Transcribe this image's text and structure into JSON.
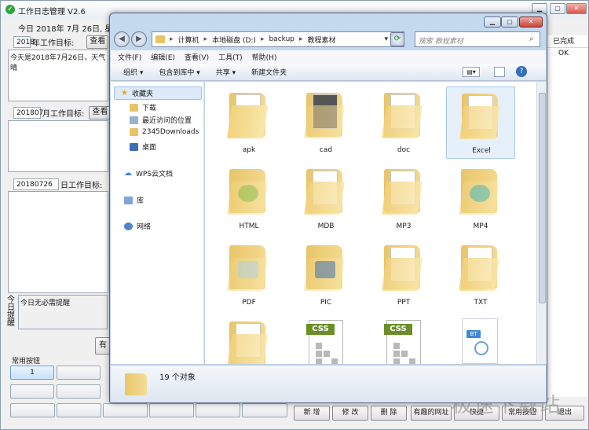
{
  "app": {
    "title": "工作日志管理 V2.6",
    "date_text": "今日 2018年 7月 26日, 星期",
    "year_input": "2018",
    "year_goal_label": "年工作目标:",
    "view_button": "查看",
    "today_text": "今天是2018年7月26日，天气晴",
    "month_input": "201807",
    "month_goal_label": "月工作目标:",
    "day_input": "20180726",
    "day_goal_label": "日工作目标:",
    "reminder_side_label": "今日提醒",
    "reminder_text": "今日无必需提醒",
    "partial_button": "有",
    "common_buttons_label": "常用按钮",
    "quick_first_label": "1",
    "bottom_buttons": [
      "新 增",
      "修 改",
      "删 除",
      "有趣的网址",
      "快捷",
      "常用按钮",
      "退出"
    ],
    "right_header": "已完成",
    "right_value": "OK",
    "watermark": "极速下载站"
  },
  "explorer": {
    "breadcrumbs": [
      "计算机",
      "本地磁盘 (D:)",
      "backup",
      "教程素材"
    ],
    "search_placeholder": "搜索 教程素材",
    "menu": [
      "文件(F)",
      "编辑(E)",
      "查看(V)",
      "工具(T)",
      "帮助(H)"
    ],
    "toolbar": [
      "组织 ▾",
      "包含到库中 ▾",
      "共享 ▾",
      "新建文件夹"
    ],
    "nav": {
      "favorites": "收藏夹",
      "downloads": "下载",
      "recent": "最近访问的位置",
      "dl2345": "2345Downloads",
      "desktop": "桌面",
      "wps": "WPS云文档",
      "library": "库",
      "network": "网络"
    },
    "files": [
      "apk",
      "cad",
      "doc",
      "Excel",
      "HTML",
      "MDB",
      "MP3",
      "MP4",
      "PDF",
      "PIC",
      "PPT",
      "TXT"
    ],
    "item_count": "19 个对象",
    "colors": {
      "folder": "#f2d27d",
      "selection": "#dceafb",
      "css_badge": "#6a8f28"
    }
  }
}
